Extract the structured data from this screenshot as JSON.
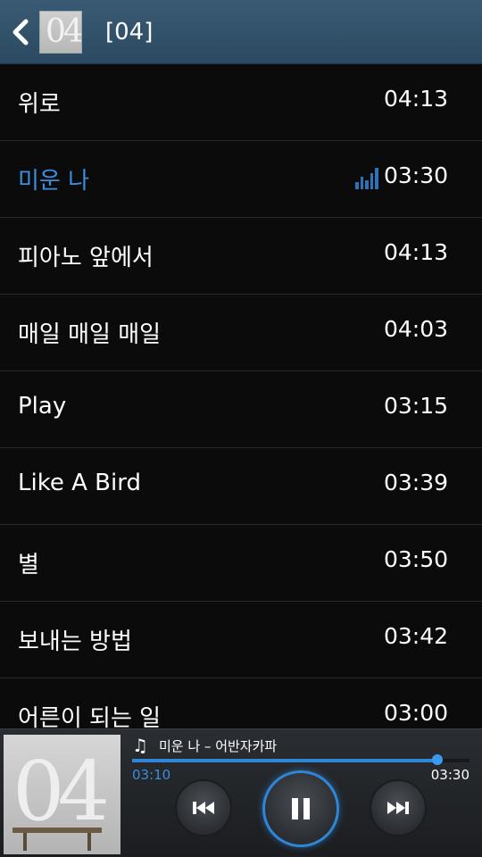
{
  "header": {
    "thumb_text": "04",
    "title": "[04]"
  },
  "tracks": [
    {
      "title": "위로",
      "duration": "04:13"
    },
    {
      "title": "미운 나",
      "duration": "03:30"
    },
    {
      "title": "피아노 앞에서",
      "duration": "04:13"
    },
    {
      "title": "매일 매일 매일",
      "duration": "04:03"
    },
    {
      "title": "Play",
      "duration": "03:15"
    },
    {
      "title": "Like A Bird",
      "duration": "03:39"
    },
    {
      "title": "별",
      "duration": "03:50"
    },
    {
      "title": "보내는 방법",
      "duration": "03:42"
    },
    {
      "title": "어른이 되는 일",
      "duration": "03:00"
    }
  ],
  "player": {
    "cover_text": "04",
    "now_playing": "미운 나 – 어반자카파",
    "elapsed": "03:10",
    "total": "03:30",
    "progress": 0.905
  },
  "colors": {
    "accent": "#3b8ee0",
    "header_bg": "#2f4f68",
    "background": "#0b0b0c"
  }
}
